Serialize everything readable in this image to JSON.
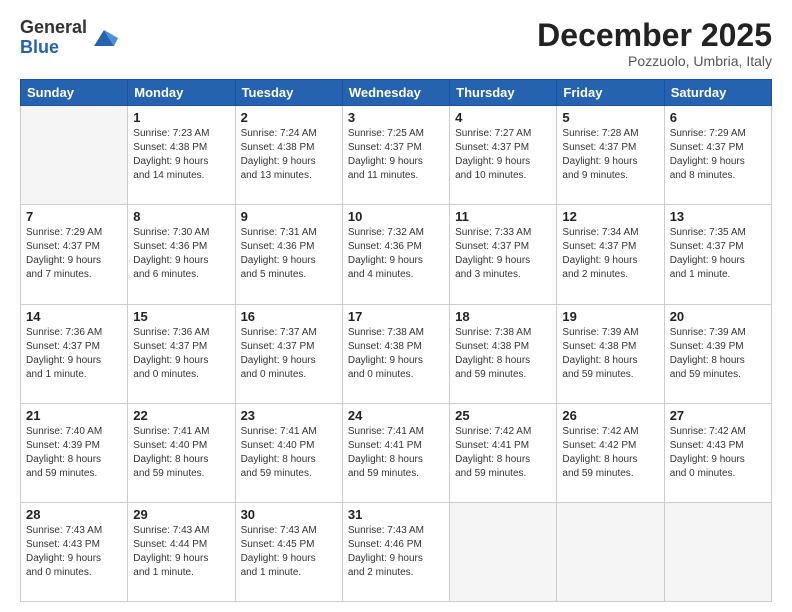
{
  "header": {
    "logo_general": "General",
    "logo_blue": "Blue",
    "month_title": "December 2025",
    "location": "Pozzuolo, Umbria, Italy"
  },
  "weekdays": [
    "Sunday",
    "Monday",
    "Tuesday",
    "Wednesday",
    "Thursday",
    "Friday",
    "Saturday"
  ],
  "weeks": [
    [
      {
        "day": "",
        "info": ""
      },
      {
        "day": "1",
        "info": "Sunrise: 7:23 AM\nSunset: 4:38 PM\nDaylight: 9 hours\nand 14 minutes."
      },
      {
        "day": "2",
        "info": "Sunrise: 7:24 AM\nSunset: 4:38 PM\nDaylight: 9 hours\nand 13 minutes."
      },
      {
        "day": "3",
        "info": "Sunrise: 7:25 AM\nSunset: 4:37 PM\nDaylight: 9 hours\nand 11 minutes."
      },
      {
        "day": "4",
        "info": "Sunrise: 7:27 AM\nSunset: 4:37 PM\nDaylight: 9 hours\nand 10 minutes."
      },
      {
        "day": "5",
        "info": "Sunrise: 7:28 AM\nSunset: 4:37 PM\nDaylight: 9 hours\nand 9 minutes."
      },
      {
        "day": "6",
        "info": "Sunrise: 7:29 AM\nSunset: 4:37 PM\nDaylight: 9 hours\nand 8 minutes."
      }
    ],
    [
      {
        "day": "7",
        "info": "Sunrise: 7:29 AM\nSunset: 4:37 PM\nDaylight: 9 hours\nand 7 minutes."
      },
      {
        "day": "8",
        "info": "Sunrise: 7:30 AM\nSunset: 4:36 PM\nDaylight: 9 hours\nand 6 minutes."
      },
      {
        "day": "9",
        "info": "Sunrise: 7:31 AM\nSunset: 4:36 PM\nDaylight: 9 hours\nand 5 minutes."
      },
      {
        "day": "10",
        "info": "Sunrise: 7:32 AM\nSunset: 4:36 PM\nDaylight: 9 hours\nand 4 minutes."
      },
      {
        "day": "11",
        "info": "Sunrise: 7:33 AM\nSunset: 4:37 PM\nDaylight: 9 hours\nand 3 minutes."
      },
      {
        "day": "12",
        "info": "Sunrise: 7:34 AM\nSunset: 4:37 PM\nDaylight: 9 hours\nand 2 minutes."
      },
      {
        "day": "13",
        "info": "Sunrise: 7:35 AM\nSunset: 4:37 PM\nDaylight: 9 hours\nand 1 minute."
      }
    ],
    [
      {
        "day": "14",
        "info": "Sunrise: 7:36 AM\nSunset: 4:37 PM\nDaylight: 9 hours\nand 1 minute."
      },
      {
        "day": "15",
        "info": "Sunrise: 7:36 AM\nSunset: 4:37 PM\nDaylight: 9 hours\nand 0 minutes."
      },
      {
        "day": "16",
        "info": "Sunrise: 7:37 AM\nSunset: 4:37 PM\nDaylight: 9 hours\nand 0 minutes."
      },
      {
        "day": "17",
        "info": "Sunrise: 7:38 AM\nSunset: 4:38 PM\nDaylight: 9 hours\nand 0 minutes."
      },
      {
        "day": "18",
        "info": "Sunrise: 7:38 AM\nSunset: 4:38 PM\nDaylight: 8 hours\nand 59 minutes."
      },
      {
        "day": "19",
        "info": "Sunrise: 7:39 AM\nSunset: 4:38 PM\nDaylight: 8 hours\nand 59 minutes."
      },
      {
        "day": "20",
        "info": "Sunrise: 7:39 AM\nSunset: 4:39 PM\nDaylight: 8 hours\nand 59 minutes."
      }
    ],
    [
      {
        "day": "21",
        "info": "Sunrise: 7:40 AM\nSunset: 4:39 PM\nDaylight: 8 hours\nand 59 minutes."
      },
      {
        "day": "22",
        "info": "Sunrise: 7:41 AM\nSunset: 4:40 PM\nDaylight: 8 hours\nand 59 minutes."
      },
      {
        "day": "23",
        "info": "Sunrise: 7:41 AM\nSunset: 4:40 PM\nDaylight: 8 hours\nand 59 minutes."
      },
      {
        "day": "24",
        "info": "Sunrise: 7:41 AM\nSunset: 4:41 PM\nDaylight: 8 hours\nand 59 minutes."
      },
      {
        "day": "25",
        "info": "Sunrise: 7:42 AM\nSunset: 4:41 PM\nDaylight: 8 hours\nand 59 minutes."
      },
      {
        "day": "26",
        "info": "Sunrise: 7:42 AM\nSunset: 4:42 PM\nDaylight: 8 hours\nand 59 minutes."
      },
      {
        "day": "27",
        "info": "Sunrise: 7:42 AM\nSunset: 4:43 PM\nDaylight: 9 hours\nand 0 minutes."
      }
    ],
    [
      {
        "day": "28",
        "info": "Sunrise: 7:43 AM\nSunset: 4:43 PM\nDaylight: 9 hours\nand 0 minutes."
      },
      {
        "day": "29",
        "info": "Sunrise: 7:43 AM\nSunset: 4:44 PM\nDaylight: 9 hours\nand 1 minute."
      },
      {
        "day": "30",
        "info": "Sunrise: 7:43 AM\nSunset: 4:45 PM\nDaylight: 9 hours\nand 1 minute."
      },
      {
        "day": "31",
        "info": "Sunrise: 7:43 AM\nSunset: 4:46 PM\nDaylight: 9 hours\nand 2 minutes."
      },
      {
        "day": "",
        "info": ""
      },
      {
        "day": "",
        "info": ""
      },
      {
        "day": "",
        "info": ""
      }
    ]
  ]
}
